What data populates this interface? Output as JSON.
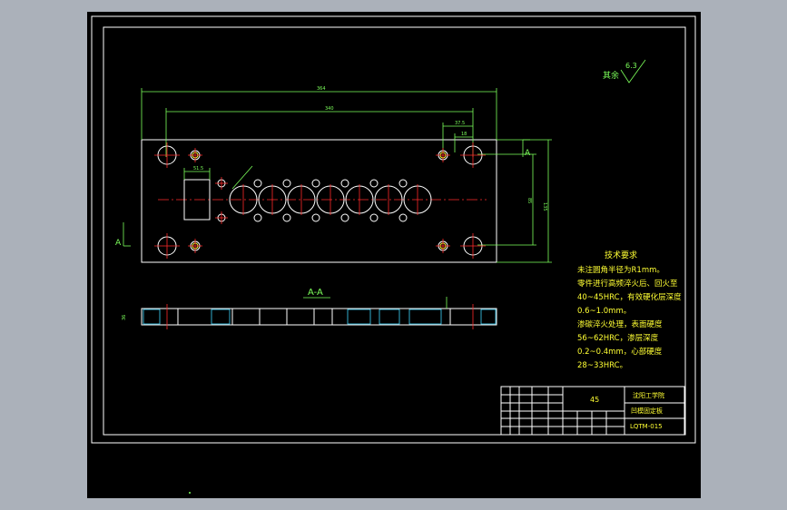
{
  "drawing": {
    "roughness_symbol_label": "其余",
    "roughness_value": "6.3",
    "section_label": "A-A",
    "section_marker_top": "A",
    "section_marker_left": "A",
    "dim_overall_width": "364",
    "dim_hole_span": "340",
    "dim_offset_right": "37.5",
    "dim_offset_right_2": "18",
    "dim_height_outer": "135",
    "dim_height_inner": "85",
    "dim_slot_width": "51.5",
    "dim_thickness": "36"
  },
  "tech_req": {
    "title": "技术要求",
    "lines": [
      "未注圆角半径为R1mm。",
      "零件进行高频淬火后、回火至",
      "40~45HRC，有效硬化层深度",
      "0.6~1.0mm。",
      "渗碳淬火处理，表面硬度",
      "56~62HRC，渗层深度",
      "0.2~0.4mm，心部硬度",
      "28~33HRC。"
    ]
  },
  "title_block": {
    "material": "45",
    "school": "沈阳工学院",
    "part_name": "凹模固定板",
    "drawing_no": "LQTM-015"
  }
}
